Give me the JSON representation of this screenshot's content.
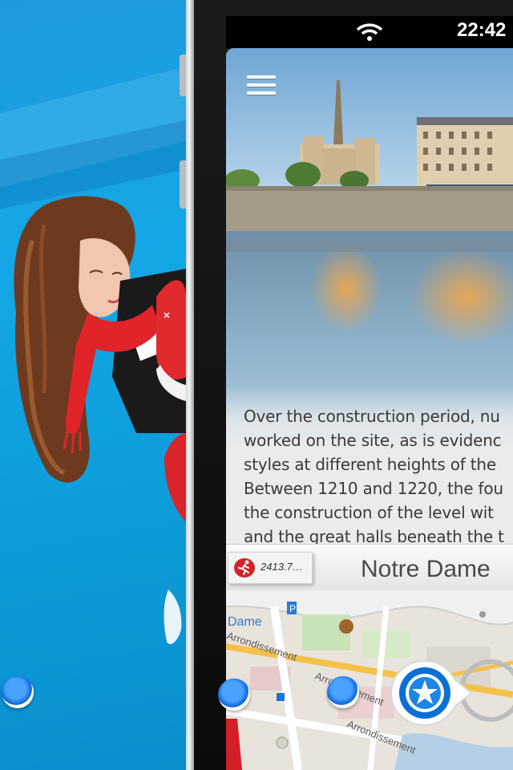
{
  "status_bar": {
    "time": "22:42",
    "wifi_icon": "wifi-icon"
  },
  "screen": {
    "menu_icon": "hamburger-menu-icon",
    "description_lines": [
      "Over the construction period, nu",
      "worked on the site, as is evidenc",
      "styles at different heights of the",
      "Between 1210 and 1220, the fou",
      "the construction of the level wit",
      "and the great halls beneath the t"
    ],
    "distance_badge": {
      "icon": "runner-icon",
      "text": "2413.7…",
      "accent": "#d0262b"
    },
    "place_title": "Notre Dame",
    "map": {
      "labels": [
        "Dame",
        "Arrondissement",
        "Arrondissement",
        "Arrondissement",
        "P"
      ],
      "nav_button_icon": "star-navigation-icon"
    }
  },
  "pager": {
    "dots": 3
  },
  "colors": {
    "promo_blue": "#13a7e6",
    "pager_blue": "#0a62d6",
    "map_road": "#f6c14a"
  }
}
